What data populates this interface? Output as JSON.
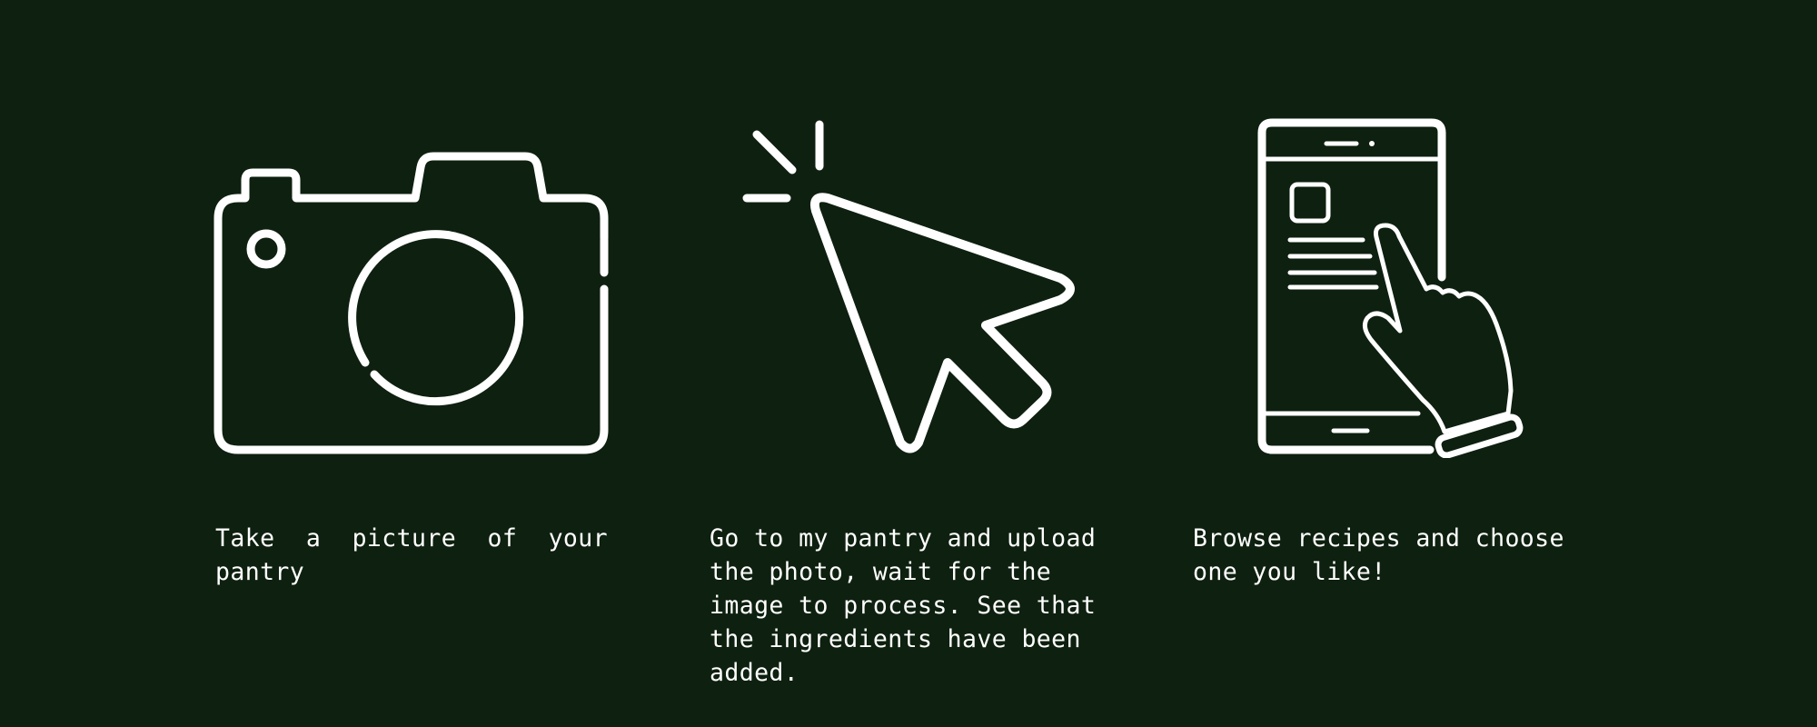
{
  "colors": {
    "background": "#0e200f",
    "foreground": "#ffffff"
  },
  "steps": [
    {
      "icon": "camera-icon",
      "text": "Take a picture of your pantry"
    },
    {
      "icon": "cursor-click-icon",
      "text": "Go to my pantry and upload the photo, wait for the image to process. See that the ingredients have been added."
    },
    {
      "icon": "phone-tap-icon",
      "text": "Browse recipes and choose one you like!"
    }
  ]
}
